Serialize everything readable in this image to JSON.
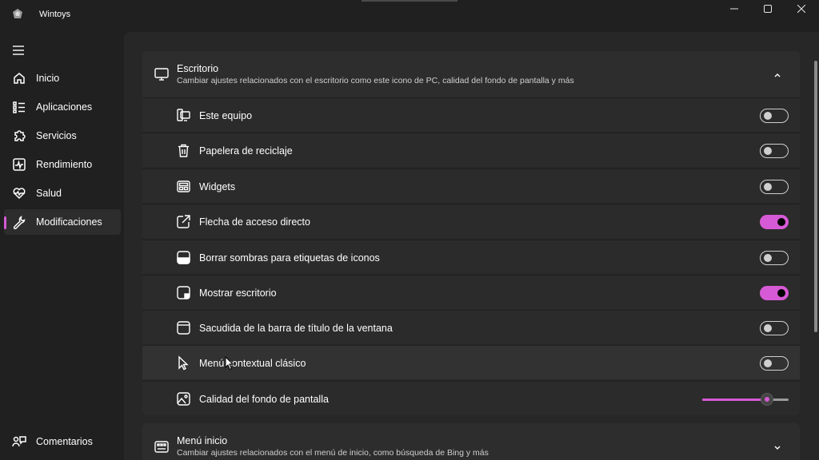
{
  "app": {
    "title": "Wintoys"
  },
  "sidebar": {
    "items": [
      {
        "label": "Inicio",
        "icon": "home-icon"
      },
      {
        "label": "Aplicaciones",
        "icon": "apps-list-icon"
      },
      {
        "label": "Servicios",
        "icon": "puzzle-icon"
      },
      {
        "label": "Rendimiento",
        "icon": "performance-icon"
      },
      {
        "label": "Salud",
        "icon": "heart-pulse-icon"
      },
      {
        "label": "Modificaciones",
        "icon": "wrench-icon",
        "active": true
      }
    ],
    "footer": {
      "label": "Comentarios",
      "icon": "feedback-icon"
    }
  },
  "sections": {
    "desktop": {
      "title": "Escritorio",
      "description": "Cambiar ajustes relacionados con el escritorio como este icono de PC, calidad del fondo de pantalla y más",
      "expanded": true,
      "settings": [
        {
          "label": "Este equipo",
          "icon": "this-pc-icon",
          "control": "toggle",
          "value": false
        },
        {
          "label": "Papelera de reciclaje",
          "icon": "recycle-bin-icon",
          "control": "toggle",
          "value": false
        },
        {
          "label": "Widgets",
          "icon": "widgets-icon",
          "control": "toggle",
          "value": false
        },
        {
          "label": "Flecha de acceso directo",
          "icon": "shortcut-arrow-icon",
          "control": "toggle",
          "value": true
        },
        {
          "label": "Borrar sombras para etiquetas de iconos",
          "icon": "shadow-icon",
          "control": "toggle",
          "value": false
        },
        {
          "label": "Mostrar escritorio",
          "icon": "show-desktop-icon",
          "control": "toggle",
          "value": true
        },
        {
          "label": "Sacudida de la barra de título de la ventana",
          "icon": "window-shake-icon",
          "control": "toggle",
          "value": false
        },
        {
          "label": "Menú contextual clásico",
          "icon": "cursor-icon",
          "control": "toggle",
          "value": false
        },
        {
          "label": "Calidad del fondo de pantalla",
          "icon": "wallpaper-icon",
          "control": "slider",
          "value": 0.79
        }
      ]
    },
    "start_menu": {
      "title": "Menú inicio",
      "description": "Cambiar ajustes relacionados con el menú de inicio, como búsqueda de Bing y más",
      "expanded": false
    }
  },
  "colors": {
    "accent": "#d65ad6",
    "background": "#202020",
    "card": "#2b2b2b"
  }
}
